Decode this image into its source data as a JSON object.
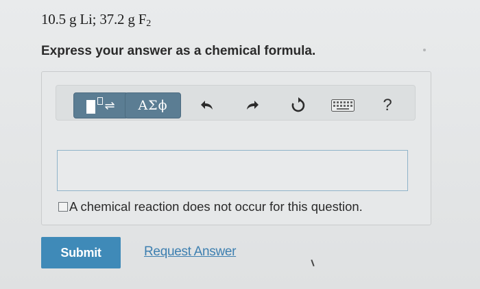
{
  "problem": {
    "mass_li": "10.5",
    "unit_li": "g",
    "element_li": "Li",
    "separator": ";",
    "mass_f": "37.2",
    "unit_f": "g",
    "element_f": "F",
    "subscript_f": "2"
  },
  "instructions": "Express your answer as a chemical formula.",
  "toolbar": {
    "templates_icon": "templates-icon",
    "greek_label": "ΑΣϕ",
    "undo_icon": "undo-icon",
    "redo_icon": "redo-icon",
    "reset_icon": "reset-icon",
    "keyboard_icon": "keyboard-icon",
    "help_label": "?"
  },
  "answer_input": {
    "value": ""
  },
  "no_reaction_checkbox": {
    "label": "A chemical reaction does not occur for this question.",
    "checked": false
  },
  "actions": {
    "submit_label": "Submit",
    "request_answer_label": "Request Answer"
  },
  "colors": {
    "submit_bg": "#3f8ab8",
    "toolbar_button_bg": "#5b7d93",
    "link": "#3d7fb0"
  }
}
